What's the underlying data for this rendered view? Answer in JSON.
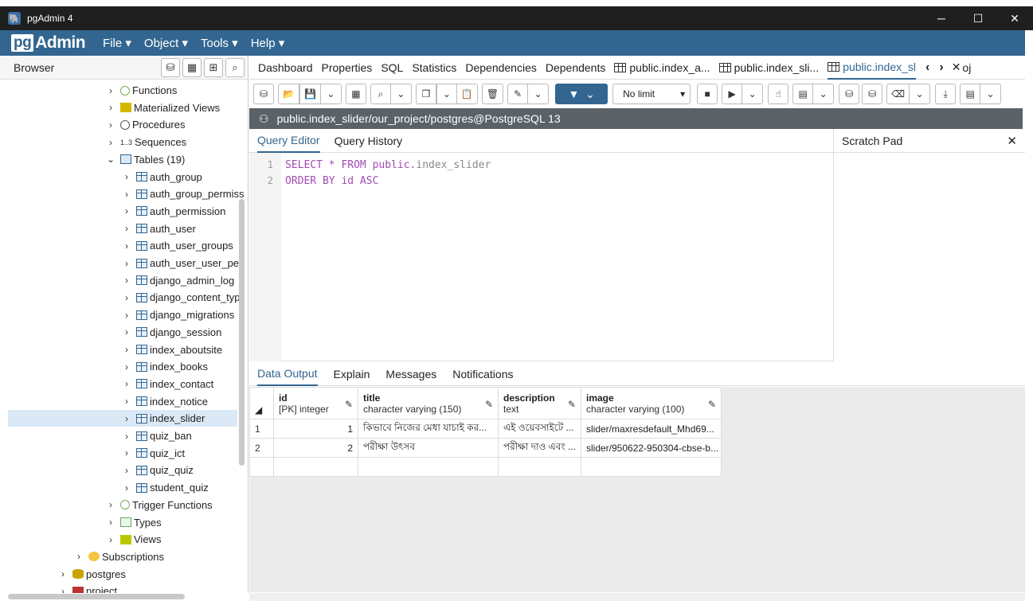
{
  "window": {
    "title": "pgAdmin 4",
    "minimize": "─",
    "maximize": "☐",
    "close": "✕"
  },
  "menubar": {
    "logo_pg": "pg",
    "logo_admin": "Admin",
    "items": [
      "File ▾",
      "Object ▾",
      "Tools ▾",
      "Help ▾"
    ]
  },
  "browser": {
    "label": "Browser",
    "tools": [
      "⛁",
      "▦",
      "⊞",
      "⌕"
    ],
    "tree": [
      {
        "label": "Functions",
        "icon": "func",
        "chev": "›",
        "indent": 1
      },
      {
        "label": "Materialized Views",
        "icon": "mview",
        "chev": "›",
        "indent": 1
      },
      {
        "label": "Procedures",
        "icon": "proc",
        "chev": "›",
        "indent": 1
      },
      {
        "label": "Sequences",
        "icon": "seq",
        "chev": "›",
        "indent": 1,
        "prefix": "1..3"
      },
      {
        "label": "Tables (19)",
        "icon": "tables",
        "chev": "⌄",
        "indent": 1
      },
      {
        "label": "auth_group",
        "icon": "table",
        "chev": "›",
        "indent": 2
      },
      {
        "label": "auth_group_permiss",
        "icon": "table",
        "chev": "›",
        "indent": 2
      },
      {
        "label": "auth_permission",
        "icon": "table",
        "chev": "›",
        "indent": 2
      },
      {
        "label": "auth_user",
        "icon": "table",
        "chev": "›",
        "indent": 2
      },
      {
        "label": "auth_user_groups",
        "icon": "table",
        "chev": "›",
        "indent": 2
      },
      {
        "label": "auth_user_user_per",
        "icon": "table",
        "chev": "›",
        "indent": 2
      },
      {
        "label": "django_admin_log",
        "icon": "table",
        "chev": "›",
        "indent": 2
      },
      {
        "label": "django_content_typ",
        "icon": "table",
        "chev": "›",
        "indent": 2
      },
      {
        "label": "django_migrations",
        "icon": "table",
        "chev": "›",
        "indent": 2
      },
      {
        "label": "django_session",
        "icon": "table",
        "chev": "›",
        "indent": 2
      },
      {
        "label": "index_aboutsite",
        "icon": "table",
        "chev": "›",
        "indent": 2
      },
      {
        "label": "index_books",
        "icon": "table",
        "chev": "›",
        "indent": 2
      },
      {
        "label": "index_contact",
        "icon": "table",
        "chev": "›",
        "indent": 2
      },
      {
        "label": "index_notice",
        "icon": "table",
        "chev": "›",
        "indent": 2
      },
      {
        "label": "index_slider",
        "icon": "table",
        "chev": "›",
        "indent": 2,
        "selected": true
      },
      {
        "label": "quiz_ban",
        "icon": "table",
        "chev": "›",
        "indent": 2
      },
      {
        "label": "quiz_ict",
        "icon": "table",
        "chev": "›",
        "indent": 2
      },
      {
        "label": "quiz_quiz",
        "icon": "table",
        "chev": "›",
        "indent": 2
      },
      {
        "label": "student_quiz",
        "icon": "table",
        "chev": "›",
        "indent": 2
      },
      {
        "label": "Trigger Functions",
        "icon": "func",
        "chev": "›",
        "indent": 1
      },
      {
        "label": "Types",
        "icon": "types",
        "chev": "›",
        "indent": 1
      },
      {
        "label": "Views",
        "icon": "views",
        "chev": "›",
        "indent": 1
      },
      {
        "label": "Subscriptions",
        "icon": "subs",
        "chev": "›",
        "indent": 0
      },
      {
        "label": "postgres",
        "icon": "db",
        "chev": "›",
        "indent": -1
      },
      {
        "label": "project",
        "icon": "proj",
        "chev": "›",
        "indent": -1
      }
    ]
  },
  "tabs": [
    {
      "label": "Dashboard",
      "grid": false
    },
    {
      "label": "Properties",
      "grid": false
    },
    {
      "label": "SQL",
      "grid": false
    },
    {
      "label": "Statistics",
      "grid": false
    },
    {
      "label": "Dependencies",
      "grid": false
    },
    {
      "label": "Dependents",
      "grid": false
    },
    {
      "label": "public.index_a...",
      "grid": true
    },
    {
      "label": "public.index_sli...",
      "grid": true
    },
    {
      "label": "public.index_sl",
      "grid": true,
      "active": true
    }
  ],
  "tabnav": {
    "prev": "‹",
    "next": "›",
    "close": "✕",
    "overflow": "oj"
  },
  "toolbar": {
    "limit": "No limit",
    "limit_caret": "▾"
  },
  "connection": {
    "icon": "⚇",
    "label": "public.index_slider/our_project/postgres@PostgreSQL 13"
  },
  "editor_tabs": {
    "query_editor": "Query Editor",
    "query_history": "Query History"
  },
  "scratch_pad": {
    "title": "Scratch Pad",
    "close": "✕"
  },
  "code": [
    {
      "ln": "1",
      "kw": "SELECT * FROM public.",
      "rest": "index_slider"
    },
    {
      "ln": "2",
      "kw": "ORDER BY id ASC",
      "rest": ""
    }
  ],
  "output_tabs": [
    "Data Output",
    "Explain",
    "Messages",
    "Notifications"
  ],
  "grid": {
    "sort_icon": "◢",
    "columns": [
      {
        "name": "id",
        "type": "[PK] integer"
      },
      {
        "name": "title",
        "type": "character varying (150)"
      },
      {
        "name": "description",
        "type": "text"
      },
      {
        "name": "image",
        "type": "character varying (100)"
      }
    ],
    "rows": [
      {
        "rownum": "1",
        "id": "1",
        "title": "কিভাবে নিজের মেধা যাচাই কর...",
        "description": "এই ওয়েবসাইটে ...",
        "image": "slider/maxresdefault_Mhd69..."
      },
      {
        "rownum": "2",
        "id": "2",
        "title": "পরীক্ষা উৎসব",
        "description": "পরীক্ষা দাও এবং ...",
        "image": "slider/950622-950304-cbse-b..."
      }
    ]
  }
}
